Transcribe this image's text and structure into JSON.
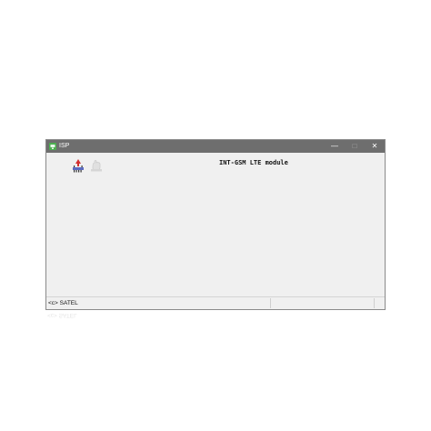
{
  "window": {
    "title": "ISP",
    "controls": {
      "minimize": "—",
      "maximize": "□",
      "close": "✕"
    }
  },
  "toolbar": {
    "icons": [
      "write-flash-icon",
      "hand-icon"
    ]
  },
  "main": {
    "module_name": "INT-GSM LTE module"
  },
  "statusbar": {
    "cell1": "<c> SATEL",
    "cell2": "",
    "cell3": ""
  },
  "reflection": {
    "text": "<c> SATEL"
  },
  "colors": {
    "titlebar": "#6e6e6e",
    "window_bg": "#f0f0f0",
    "app_icon_green": "#4caf50"
  }
}
